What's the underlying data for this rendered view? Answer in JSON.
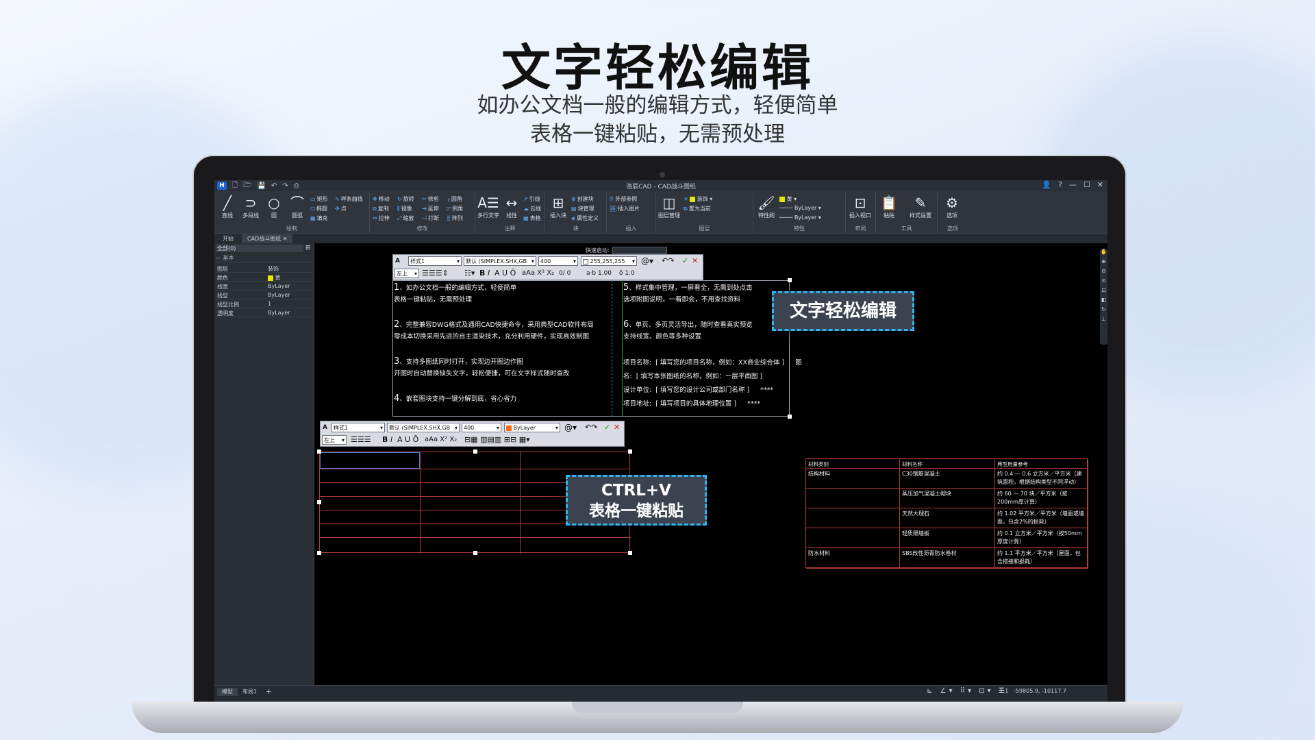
{
  "hero": {
    "title": "文字轻松编辑",
    "subtitle1": "如办公文档一般的编辑方式，轻便简单",
    "subtitle2": "表格一键粘贴，无需预处理"
  },
  "app": {
    "window_title": "浩辰CAD - CAD战斗图纸",
    "logo": "H",
    "ribbon_groups": [
      {
        "label": "绘制"
      },
      {
        "label": "修改"
      },
      {
        "label": "注释"
      },
      {
        "label": "块"
      },
      {
        "label": "插入"
      },
      {
        "label": "图层"
      },
      {
        "label": "特性"
      },
      {
        "label": "布局"
      },
      {
        "label": "工具"
      },
      {
        "label": "选项"
      }
    ],
    "draw_tools": [
      "直线",
      "多段线",
      "圆",
      "圆弧"
    ],
    "draw_small": [
      "矩形",
      "椭圆",
      "填充",
      "样条曲线",
      "点"
    ],
    "modify_small": [
      "移动",
      "旋转",
      "修剪",
      "圆角",
      "复制",
      "镜像",
      "延伸",
      "倒角",
      "拉伸",
      "缩放",
      "打断",
      "阵列"
    ],
    "annot": [
      "多行文字",
      "线性",
      "引线",
      "云线",
      "表格"
    ],
    "block": [
      "插入块",
      "创建块",
      "块管理",
      "属性定义"
    ],
    "insert": [
      "外部参照",
      "插入图片"
    ],
    "layer": {
      "manager": "图层管理",
      "current": "装饰",
      "set_current": "置为当前"
    },
    "props_ribbon": {
      "match": "特性刷",
      "color": "黄",
      "linetype": "ByLayer",
      "lineweight": "ByLayer"
    },
    "layout": {
      "viewport": "插入视口"
    },
    "tools": {
      "paste": "粘贴",
      "style": "样式设置"
    },
    "options": "选项",
    "doc_tabs": [
      "开始",
      "CAD战斗图纸"
    ],
    "props_panel": {
      "select": "全部(0)",
      "group": "基本",
      "rows": [
        {
          "key": "图层",
          "value": "装饰"
        },
        {
          "key": "颜色",
          "value": "黄"
        },
        {
          "key": "线宽",
          "value": "ByLayer"
        },
        {
          "key": "线型",
          "value": "ByLayer"
        },
        {
          "key": "线型比例",
          "value": "1"
        },
        {
          "key": "透明度",
          "value": "ByLayer"
        }
      ]
    },
    "quick_label": "快速启动:",
    "toolbar1": {
      "style": "样式1",
      "font": "默认 (SIMPLEX.SHX,GB",
      "height": "400",
      "color": "255,255,255",
      "align": "左上",
      "spacing": "1.00",
      "width": "1.0",
      "oblique": "0"
    },
    "toolbar2": {
      "style": "样式1",
      "font": "默认 (SIMPLEX.SHX,GB",
      "height": "400",
      "color": "ByLayer",
      "align": "左上"
    },
    "mtext_left": [
      {
        "n": "1",
        "t": "、如办公文档一般的编辑方式，轻便简单"
      },
      {
        "n": "",
        "t": "表格一键粘贴，无需预处理"
      },
      {
        "n": "",
        "t": ""
      },
      {
        "n": "2",
        "t": "、完整兼容DWG格式及通用CAD快捷命令，采用典型CAD软件布局"
      },
      {
        "n": "",
        "t": "零成本切换采用先进的自主渲染技术，充分利用硬件，实现高效制图"
      },
      {
        "n": "",
        "t": ""
      },
      {
        "n": "3",
        "t": "、支持多图纸同时打开，实现边开图边作图"
      },
      {
        "n": "",
        "t": "开图时自动替换缺失文字，轻松便捷，可在文字样式随时查改"
      },
      {
        "n": "",
        "t": ""
      },
      {
        "n": "4",
        "t": "、嵌套图块支持一键分解到底，省心省力"
      }
    ],
    "mtext_right": [
      {
        "n": "5",
        "t": "、样式集中管理，一屏看全，无需到处点击"
      },
      {
        "n": "",
        "t": "选项附图说明，一看即会，不用查找资料"
      },
      {
        "n": "",
        "t": ""
      },
      {
        "n": "6",
        "t": "、单页、多页灵活导出，随时查看真实预览"
      },
      {
        "n": "",
        "t": "支持线宽、颜色等多种设置"
      }
    ],
    "project_fields": [
      {
        "k": "项目名称:",
        "v": "[ 填写您的项目名称，例如：XX商业综合体 ]",
        "tail": "图"
      },
      {
        "k": "名:",
        "v": "[ 填写本张图纸的名称，例如：一层平面图 ]",
        "tail": ""
      },
      {
        "k": "设计单位:",
        "v": "[ 填写您的设计公司或部门名称 ]",
        "tail": "****"
      },
      {
        "k": "项目地址:",
        "v": "[ 填写项目的具体地理位置 ]",
        "tail": "****"
      }
    ],
    "callout_text": "文字轻松编辑",
    "callout_paste_line1": "CTRL+V",
    "callout_paste_line2": "表格一键粘贴",
    "material_table": [
      [
        "材料类别",
        "材料名称",
        "典型用量参考"
      ],
      [
        "结构材料",
        "C30钢筋混凝土",
        "约 0.4 — 0.6 立方米／平方米（建筑面积，根据结构类型不同浮动）"
      ],
      [
        "",
        "蒸压加气混凝土砌块",
        "约 60 — 70 块／平方米（按200mm厚计算）"
      ],
      [
        "",
        "天然大理石",
        "约 1.02 平方米／平方米（墙面或墙面，包含2%的损耗）"
      ],
      [
        "",
        "轻质隔墙板",
        "约 0.1 立方米／平方米（按50mm厚度计算）"
      ],
      [
        "防水材料",
        "SBS改性沥青防水卷材",
        "约 1.1 平方米／平方米（屋面，包含搭接和损耗）"
      ]
    ],
    "layout_tabs": [
      "模型",
      "布局1",
      "+"
    ],
    "status": {
      "scale": "1:1",
      "coords": "-59805.9, -10117.7"
    }
  },
  "colors": {
    "accent": "#2fb6f0",
    "table_line": "#b23b3b",
    "ribbon_bg": "#2f343d"
  }
}
